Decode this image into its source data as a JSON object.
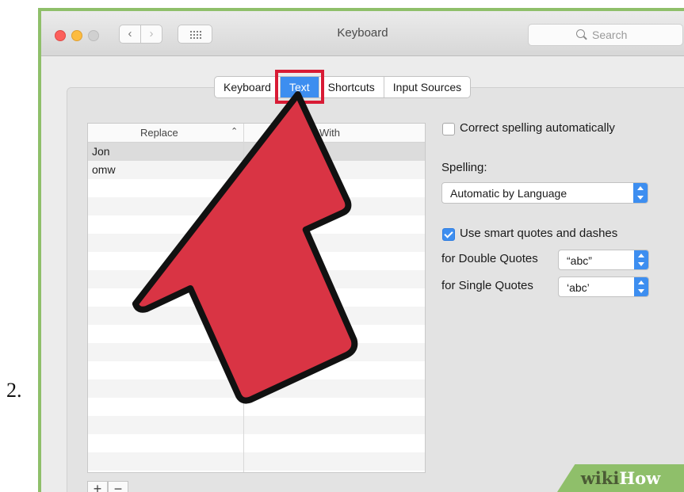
{
  "step_number": "2.",
  "window": {
    "title": "Keyboard",
    "search_placeholder": "Search"
  },
  "tabs": [
    {
      "label": "Keyboard",
      "active": false
    },
    {
      "label": "Text",
      "active": true
    },
    {
      "label": "Shortcuts",
      "active": false
    },
    {
      "label": "Input Sources",
      "active": false
    }
  ],
  "table": {
    "col_replace": "Replace",
    "col_with": "With",
    "rows": [
      {
        "replace": "Jon",
        "with": ""
      },
      {
        "replace": "omw",
        "with": ""
      }
    ],
    "add_label": "+",
    "remove_label": "−"
  },
  "settings": {
    "correct_spelling": {
      "label": "Correct spelling automatically",
      "checked": false
    },
    "spelling_label": "Spelling:",
    "spelling_value": "Automatic by Language",
    "smart_quotes": {
      "label": "Use smart quotes and dashes",
      "checked": true
    },
    "double_quotes_label": "for Double Quotes",
    "double_quotes_value": "“abc”",
    "single_quotes_label": "for Single Quotes",
    "single_quotes_value": "‘abc’"
  },
  "watermark": {
    "part1": "wiki",
    "part2": "How"
  },
  "colors": {
    "accent": "#3d8ef0",
    "highlight": "#d81b35",
    "arrow_fill": "#d93444",
    "frame": "#8fbf6a"
  }
}
